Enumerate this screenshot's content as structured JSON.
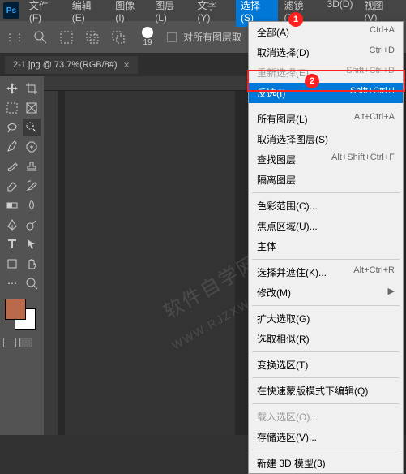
{
  "menubar": {
    "logo": "Ps",
    "items": [
      {
        "label": "文件(F)"
      },
      {
        "label": "编辑(E)"
      },
      {
        "label": "图像(I)"
      },
      {
        "label": "图层(L)"
      },
      {
        "label": "文字(Y)"
      },
      {
        "label": "选择(S)",
        "open": true
      },
      {
        "label": "滤镜(T)"
      },
      {
        "label": "3D(D)"
      },
      {
        "label": "视图(V)"
      }
    ]
  },
  "toolbar": {
    "brush_size": "19",
    "checkbox_label": "对所有图层取"
  },
  "tab": {
    "title": "2-1.jpg @ 73.7%(RGB/8#)",
    "close": "×"
  },
  "badges": {
    "b1": "1",
    "b2": "2"
  },
  "dropdown": {
    "groups": [
      [
        {
          "label": "全部(A)",
          "shortcut": "Ctrl+A"
        },
        {
          "label": "取消选择(D)",
          "shortcut": "Ctrl+D"
        },
        {
          "label": "重新选择(E)",
          "shortcut": "Shift+Ctrl+D",
          "dis": true
        },
        {
          "label": "反选(I)",
          "shortcut": "Shift+Ctrl+I",
          "sel": true
        }
      ],
      [
        {
          "label": "所有图层(L)",
          "shortcut": "Alt+Ctrl+A"
        },
        {
          "label": "取消选择图层(S)",
          "shortcut": ""
        },
        {
          "label": "查找图层",
          "shortcut": "Alt+Shift+Ctrl+F"
        },
        {
          "label": "隔离图层",
          "shortcut": ""
        }
      ],
      [
        {
          "label": "色彩范围(C)...",
          "shortcut": ""
        },
        {
          "label": "焦点区域(U)...",
          "shortcut": ""
        },
        {
          "label": "主体",
          "shortcut": ""
        }
      ],
      [
        {
          "label": "选择并遮住(K)...",
          "shortcut": "Alt+Ctrl+R"
        },
        {
          "label": "修改(M)",
          "shortcut": "▶"
        }
      ],
      [
        {
          "label": "扩大选取(G)",
          "shortcut": ""
        },
        {
          "label": "选取相似(R)",
          "shortcut": ""
        }
      ],
      [
        {
          "label": "变换选区(T)",
          "shortcut": ""
        }
      ],
      [
        {
          "label": "在快速蒙版模式下编辑(Q)",
          "shortcut": ""
        }
      ],
      [
        {
          "label": "载入选区(O)...",
          "shortcut": "",
          "dis": true
        },
        {
          "label": "存储选区(V)...",
          "shortcut": ""
        }
      ],
      [
        {
          "label": "新建 3D 模型(3)",
          "shortcut": ""
        }
      ]
    ]
  },
  "watermark": {
    "text1": "软件自学网",
    "text2": "WWW.RJZXW.CO"
  }
}
